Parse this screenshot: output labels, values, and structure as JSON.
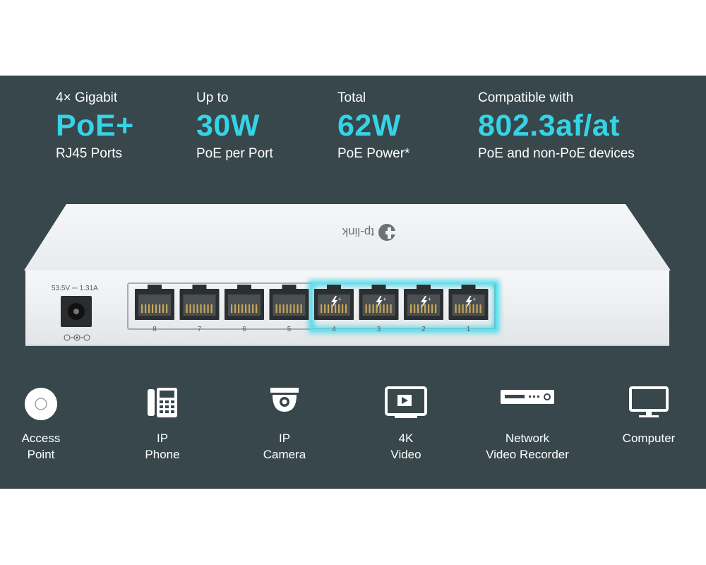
{
  "specs": [
    {
      "id": "gigabit",
      "top": "4× Gigabit",
      "big": "PoE+",
      "bottom": "RJ45 Ports"
    },
    {
      "id": "per-port",
      "top": "Up to",
      "big": "30W",
      "bottom": "PoE per Port"
    },
    {
      "id": "total",
      "top": "Total",
      "big": "62W",
      "bottom": "PoE Power*"
    },
    {
      "id": "compat",
      "top": "Compatible with",
      "big": "802.3af/at",
      "bottom": "PoE and non-PoE devices"
    }
  ],
  "switch": {
    "brand": "tp-link",
    "power_rating": "53.5V ⎓ 1.31A",
    "ports": [
      "8",
      "7",
      "6",
      "5",
      "4",
      "3",
      "2",
      "1"
    ],
    "poe_ports": [
      "4",
      "3",
      "2",
      "1"
    ]
  },
  "devices": [
    {
      "id": "access-point",
      "line1": "Access",
      "line2": "Point",
      "icon": "access-point-icon"
    },
    {
      "id": "ip-phone",
      "line1": "IP",
      "line2": "Phone",
      "icon": "ip-phone-icon"
    },
    {
      "id": "ip-camera",
      "line1": "IP",
      "line2": "Camera",
      "icon": "ip-camera-icon"
    },
    {
      "id": "4k-video",
      "line1": "4K",
      "line2": "Video",
      "icon": "video-monitor-icon"
    },
    {
      "id": "nvr",
      "line1": "Network",
      "line2": "Video Recorder",
      "icon": "video-recorder-icon"
    },
    {
      "id": "computer",
      "line1": "Computer",
      "line2": "",
      "icon": "computer-monitor-icon"
    }
  ],
  "colors": {
    "panel": "#37474b",
    "accent": "#35d3e6",
    "text": "#ffffff"
  }
}
